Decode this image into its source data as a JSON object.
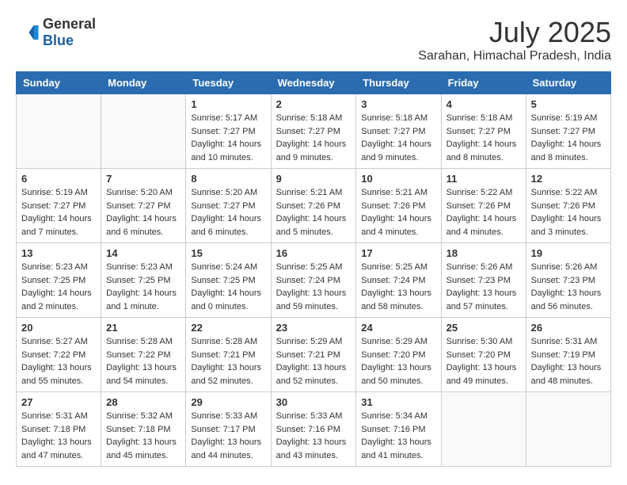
{
  "header": {
    "logo": {
      "general": "General",
      "blue": "Blue"
    },
    "month_year": "July 2025",
    "location": "Sarahan, Himachal Pradesh, India"
  },
  "weekdays": [
    "Sunday",
    "Monday",
    "Tuesday",
    "Wednesday",
    "Thursday",
    "Friday",
    "Saturday"
  ],
  "weeks": [
    [
      {
        "day": "",
        "info": ""
      },
      {
        "day": "",
        "info": ""
      },
      {
        "day": "1",
        "info": "Sunrise: 5:17 AM\nSunset: 7:27 PM\nDaylight: 14 hours and 10 minutes."
      },
      {
        "day": "2",
        "info": "Sunrise: 5:18 AM\nSunset: 7:27 PM\nDaylight: 14 hours and 9 minutes."
      },
      {
        "day": "3",
        "info": "Sunrise: 5:18 AM\nSunset: 7:27 PM\nDaylight: 14 hours and 9 minutes."
      },
      {
        "day": "4",
        "info": "Sunrise: 5:18 AM\nSunset: 7:27 PM\nDaylight: 14 hours and 8 minutes."
      },
      {
        "day": "5",
        "info": "Sunrise: 5:19 AM\nSunset: 7:27 PM\nDaylight: 14 hours and 8 minutes."
      }
    ],
    [
      {
        "day": "6",
        "info": "Sunrise: 5:19 AM\nSunset: 7:27 PM\nDaylight: 14 hours and 7 minutes."
      },
      {
        "day": "7",
        "info": "Sunrise: 5:20 AM\nSunset: 7:27 PM\nDaylight: 14 hours and 6 minutes."
      },
      {
        "day": "8",
        "info": "Sunrise: 5:20 AM\nSunset: 7:27 PM\nDaylight: 14 hours and 6 minutes."
      },
      {
        "day": "9",
        "info": "Sunrise: 5:21 AM\nSunset: 7:26 PM\nDaylight: 14 hours and 5 minutes."
      },
      {
        "day": "10",
        "info": "Sunrise: 5:21 AM\nSunset: 7:26 PM\nDaylight: 14 hours and 4 minutes."
      },
      {
        "day": "11",
        "info": "Sunrise: 5:22 AM\nSunset: 7:26 PM\nDaylight: 14 hours and 4 minutes."
      },
      {
        "day": "12",
        "info": "Sunrise: 5:22 AM\nSunset: 7:26 PM\nDaylight: 14 hours and 3 minutes."
      }
    ],
    [
      {
        "day": "13",
        "info": "Sunrise: 5:23 AM\nSunset: 7:25 PM\nDaylight: 14 hours and 2 minutes."
      },
      {
        "day": "14",
        "info": "Sunrise: 5:23 AM\nSunset: 7:25 PM\nDaylight: 14 hours and 1 minute."
      },
      {
        "day": "15",
        "info": "Sunrise: 5:24 AM\nSunset: 7:25 PM\nDaylight: 14 hours and 0 minutes."
      },
      {
        "day": "16",
        "info": "Sunrise: 5:25 AM\nSunset: 7:24 PM\nDaylight: 13 hours and 59 minutes."
      },
      {
        "day": "17",
        "info": "Sunrise: 5:25 AM\nSunset: 7:24 PM\nDaylight: 13 hours and 58 minutes."
      },
      {
        "day": "18",
        "info": "Sunrise: 5:26 AM\nSunset: 7:23 PM\nDaylight: 13 hours and 57 minutes."
      },
      {
        "day": "19",
        "info": "Sunrise: 5:26 AM\nSunset: 7:23 PM\nDaylight: 13 hours and 56 minutes."
      }
    ],
    [
      {
        "day": "20",
        "info": "Sunrise: 5:27 AM\nSunset: 7:22 PM\nDaylight: 13 hours and 55 minutes."
      },
      {
        "day": "21",
        "info": "Sunrise: 5:28 AM\nSunset: 7:22 PM\nDaylight: 13 hours and 54 minutes."
      },
      {
        "day": "22",
        "info": "Sunrise: 5:28 AM\nSunset: 7:21 PM\nDaylight: 13 hours and 52 minutes."
      },
      {
        "day": "23",
        "info": "Sunrise: 5:29 AM\nSunset: 7:21 PM\nDaylight: 13 hours and 52 minutes."
      },
      {
        "day": "24",
        "info": "Sunrise: 5:29 AM\nSunset: 7:20 PM\nDaylight: 13 hours and 50 minutes."
      },
      {
        "day": "25",
        "info": "Sunrise: 5:30 AM\nSunset: 7:20 PM\nDaylight: 13 hours and 49 minutes."
      },
      {
        "day": "26",
        "info": "Sunrise: 5:31 AM\nSunset: 7:19 PM\nDaylight: 13 hours and 48 minutes."
      }
    ],
    [
      {
        "day": "27",
        "info": "Sunrise: 5:31 AM\nSunset: 7:18 PM\nDaylight: 13 hours and 47 minutes."
      },
      {
        "day": "28",
        "info": "Sunrise: 5:32 AM\nSunset: 7:18 PM\nDaylight: 13 hours and 45 minutes."
      },
      {
        "day": "29",
        "info": "Sunrise: 5:33 AM\nSunset: 7:17 PM\nDaylight: 13 hours and 44 minutes."
      },
      {
        "day": "30",
        "info": "Sunrise: 5:33 AM\nSunset: 7:16 PM\nDaylight: 13 hours and 43 minutes."
      },
      {
        "day": "31",
        "info": "Sunrise: 5:34 AM\nSunset: 7:16 PM\nDaylight: 13 hours and 41 minutes."
      },
      {
        "day": "",
        "info": ""
      },
      {
        "day": "",
        "info": ""
      }
    ]
  ]
}
